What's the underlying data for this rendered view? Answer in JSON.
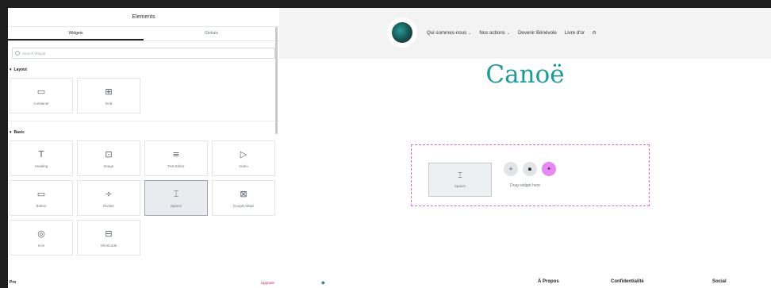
{
  "panel": {
    "title": "Elements",
    "tabs": [
      {
        "label": "Widgets",
        "active": true
      },
      {
        "label": "Globals",
        "active": false
      }
    ],
    "search_placeholder": "Search Widget",
    "sections": {
      "layout": {
        "title": "Layout",
        "widgets": [
          {
            "label": "Container",
            "icon": "container-icon"
          },
          {
            "label": "Grid",
            "icon": "grid-icon"
          }
        ]
      },
      "basic": {
        "title": "Basic",
        "widgets": [
          {
            "label": "Heading",
            "icon": "heading-icon"
          },
          {
            "label": "Image",
            "icon": "image-icon"
          },
          {
            "label": "Text Editor",
            "icon": "text-editor-icon"
          },
          {
            "label": "Video",
            "icon": "video-icon"
          },
          {
            "label": "Button",
            "icon": "button-icon"
          },
          {
            "label": "Divider",
            "icon": "divider-icon"
          },
          {
            "label": "Spacer",
            "icon": "spacer-icon",
            "selected": true
          },
          {
            "label": "Google Maps",
            "icon": "map-icon"
          },
          {
            "label": "Icon",
            "icon": "icon-icon"
          },
          {
            "label": "Shortcode",
            "icon": "shortcode-icon"
          }
        ]
      }
    },
    "pro": {
      "label": "Pro",
      "upgrade": "Upgrade"
    }
  },
  "site": {
    "nav": [
      {
        "label": "Qui sommes-nous",
        "dropdown": true
      },
      {
        "label": "Nos actions",
        "dropdown": true
      },
      {
        "label": "Devenir Bénévole",
        "dropdown": false
      },
      {
        "label": "Livre d'or",
        "dropdown": false
      }
    ],
    "user_icon": "user-icon",
    "page_title": "Canoë",
    "title_color": "#1f9a99",
    "dropzone": {
      "spacer_label": "Spacer",
      "hint": "Drag widget here",
      "accent": "#d36ad6"
    },
    "footer": {
      "links": [
        "À Propos",
        "Confidentialité",
        "Social"
      ]
    }
  }
}
